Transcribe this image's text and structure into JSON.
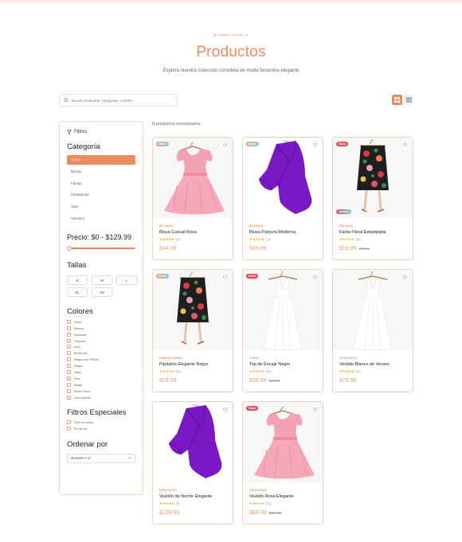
{
  "hero": {
    "kicker": "Nuestra Colección",
    "title": "Productos",
    "subtitle": "Explora nuestra colección completa de moda femenina elegante"
  },
  "search": {
    "placeholder": "Buscar productos, categorías, colores..."
  },
  "view": {
    "active": "grid"
  },
  "results": {
    "count_text": "8 productos encontrados"
  },
  "sidebar": {
    "filters_label": "Filtros",
    "category_title": "Categoría",
    "categories": [
      "Todos",
      "Blusas",
      "Faldas",
      "Pantalones",
      "Tops",
      "Vestidos"
    ],
    "price_title": "Precio: $0 - $129.99",
    "price_range": [
      0,
      129.99
    ],
    "sizes_title": "Tallas",
    "sizes": [
      "S",
      "M",
      "L",
      "XL",
      "XS"
    ],
    "colors_title": "Colores",
    "colors": [
      "Rosa",
      "Blanco",
      "Lavanda",
      "Púrpura",
      "Azul",
      "Multicolor",
      "Negro con Flores",
      "Negro",
      "Navy",
      "Gris",
      "Beige",
      "Rosa Claro",
      "Azul Marino"
    ],
    "special_title": "Filtros Especiales",
    "special": [
      "Solo en stock",
      "En oferta"
    ],
    "sort_title": "Ordenar por",
    "sort_value": "Nombre A-Z"
  },
  "accent_color": "#f08a5d",
  "products": [
    {
      "category": "BLUSAS",
      "name": "Blusa Casual Rosa",
      "stars": "★★★★★",
      "reviews": "(22)",
      "price": "$44.99",
      "old_price": "",
      "badge": "Nuevo",
      "badge2": "",
      "image": "pink-dress"
    },
    {
      "category": "BLUSAS",
      "name": "Blusa Púrpura Moderna",
      "stars": "★★★★★",
      "reviews": "(18)",
      "price": "$49.99",
      "old_price": "",
      "badge": "Nuevo",
      "badge2": "",
      "image": "purple-blouse"
    },
    {
      "category": "FALDAS",
      "name": "Falda Floral Estampada",
      "stars": "★★★★★",
      "reviews": "(31)",
      "price": "$59.99",
      "old_price": "$79.99",
      "badge": "Oferta",
      "badge2": "Agotado",
      "image": "floral-skirt"
    },
    {
      "category": "PANTALONES",
      "name": "Pantalón Elegante Negro",
      "stars": "★★★★★",
      "reviews": "(19)",
      "price": "$69.99",
      "old_price": "",
      "badge": "Nuevo",
      "badge2": "",
      "image": "floral-skirt"
    },
    {
      "category": "TOPS",
      "name": "Top de Encaje Negro",
      "stars": "★★★★★",
      "reviews": "(15)",
      "price": "$39.99",
      "old_price": "$59.99",
      "badge": "Oferta",
      "badge2": "",
      "image": "white-dress"
    },
    {
      "category": "VESTIDOS",
      "name": "Vestido Blanco de Verano",
      "stars": "★★★★★",
      "reviews": "(27)",
      "price": "$79.99",
      "old_price": "",
      "badge": "",
      "badge2": "",
      "image": "white-dress"
    },
    {
      "category": "VESTIDOS",
      "name": "Vestido de Noche Elegante",
      "stars": "★★★★★",
      "reviews": "(8)",
      "price": "$129.99",
      "old_price": "",
      "badge": "",
      "badge2": "",
      "image": "purple-blouse"
    },
    {
      "category": "VESTIDOS",
      "name": "Vestido Rosa Elegante",
      "stars": "★★★★★",
      "reviews": "(12)",
      "price": "$89.99",
      "old_price": "$119.99",
      "badge": "Oferta",
      "badge2": "",
      "image": "pink-dress"
    }
  ]
}
